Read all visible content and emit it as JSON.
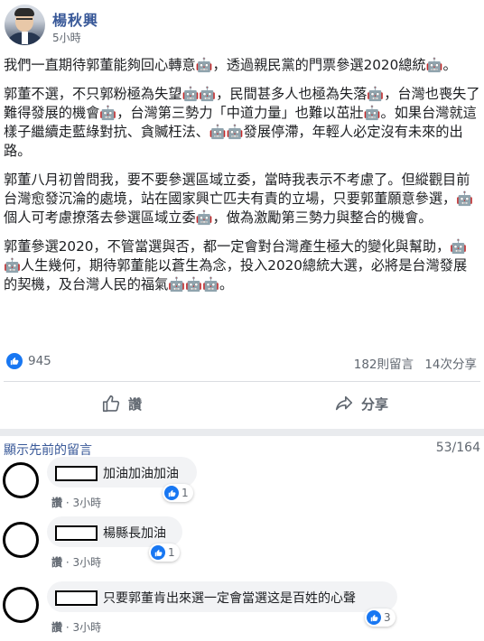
{
  "post": {
    "author": "楊秋興",
    "time": "5小時",
    "paragraphs": [
      "我們一直期待郭董能夠回心轉意🤖，透過親民黨的門票參選2020總統🤖。",
      "郭董不選，不只郭粉極為失望🤖🤖，民間甚多人也極為失落🤖，台灣也喪失了難得發展的機會🤖，台灣第三勢力「中道力量」也難以茁壯🤖。如果台灣就這樣子繼續走藍綠對抗、貪贓枉法、🤖🤖發展停滯，年輕人必定沒有未來的出路。",
      "郭董八月初曾問我，要不要參選區域立委，當時我表示不考慮了。但縱觀目前台灣愈發沉淪的處境，站在國家興亡匹夫有責的立場，只要郭董願意參選，🤖個人可考慮撩落去參選區域立委🤖，做為激勵第三勢力與整合的機會。",
      "郭董參選2020，不管當選與否，都一定會對台灣產生極大的變化與幫助，🤖🤖人生幾何，期待郭董能以蒼生為念，投入2020總統大選，必將是台灣發展的契機，及台灣人民的福氣🤖🤖🤖。"
    ]
  },
  "stats": {
    "likes": "945",
    "comments": "182則留言",
    "shares": "14次分享"
  },
  "actions": {
    "like": "讚",
    "share": "分享"
  },
  "comments_section": {
    "show_previous": "顯示先前的留言",
    "count": "53/164"
  },
  "comments": [
    {
      "text": "加油加油加油",
      "like_label": "讚",
      "time": "3小時",
      "reactions": "1"
    },
    {
      "text": "楊縣長加油",
      "like_label": "讚",
      "time": "3小時",
      "reactions": "1"
    },
    {
      "text": "只要郭董肯出來選一定會當選这是百姓的心聲",
      "like_label": "讚",
      "time": "3小時",
      "reactions": "3"
    }
  ],
  "colors": {
    "link": "#385898",
    "accent": "#1877f2",
    "muted": "#606770"
  }
}
